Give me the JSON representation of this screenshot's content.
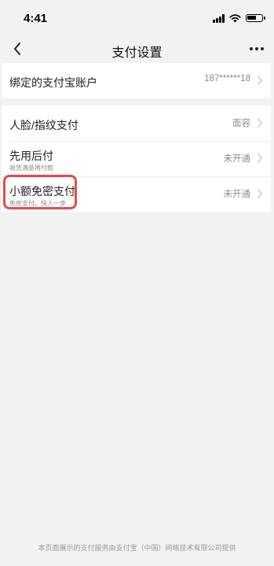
{
  "status_bar": {
    "time": "4:41"
  },
  "nav": {
    "title": "支付设置"
  },
  "rows": [
    {
      "title": "绑定的支付宝账户",
      "value": "187******18"
    },
    {
      "title": "人脸/指纹支付",
      "value": "面容"
    },
    {
      "title": "先用后付",
      "subtitle": "收货满意再付款",
      "value": "未开通"
    },
    {
      "title": "小额免密支付",
      "subtitle": "免密支付，快人一步",
      "value": "未开通"
    }
  ],
  "footer": "本页面展示的支付服务由支付宝（中国）网络技术有限公司提供",
  "colors": {
    "highlight": "#e84a4a",
    "background": "#f2f2f2"
  }
}
